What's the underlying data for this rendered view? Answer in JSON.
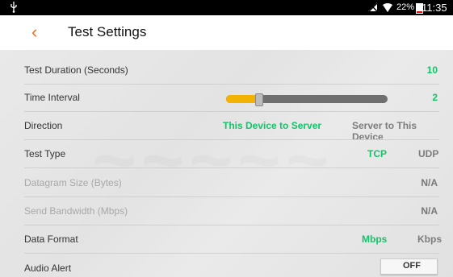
{
  "status_bar": {
    "battery_percent": "22%",
    "time": "11:35 AM",
    "battery_level": 0.22,
    "battery_color": "#e11111",
    "icons": [
      "usb-icon",
      "no-signal-icon",
      "wifi-icon",
      "battery-icon"
    ]
  },
  "app_bar": {
    "title": "Test Settings",
    "back_icon": "chevron-left-icon",
    "accent_color": "#f36c21"
  },
  "settings": {
    "test_duration": {
      "label": "Test Duration (Seconds)",
      "value": "10"
    },
    "time_interval": {
      "label": "Time Interval",
      "value": "2",
      "slider_fraction": 0.2
    },
    "direction": {
      "label": "Direction",
      "option_selected": "This Device to Server",
      "option_other": "Server to This Device"
    },
    "test_type": {
      "label": "Test Type",
      "option_selected": "TCP",
      "option_other": "UDP"
    },
    "datagram_size": {
      "label": "Datagram Size (Bytes)",
      "value": "N/A"
    },
    "send_bandwidth": {
      "label": "Send Bandwidth (Mbps)",
      "value": "N/A"
    },
    "data_format": {
      "label": "Data Format",
      "option_selected": "Mbps",
      "option_other": "Kbps"
    },
    "audio_alert": {
      "label": "Audio Alert",
      "toggle_label": "OFF"
    }
  },
  "colors": {
    "selected_option": "#15c36a",
    "unselected_option": "#7c7c7c",
    "slider_fill": "#f2b300"
  }
}
